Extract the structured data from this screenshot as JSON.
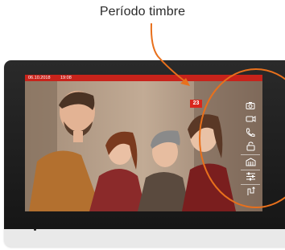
{
  "annotation": {
    "label": "Período timbre"
  },
  "status_bar": {
    "date": "06.10.2018",
    "time": "19:08"
  },
  "ring_counter": "23",
  "side_menu": {
    "items": [
      {
        "name": "snapshot",
        "icon": "camera-icon"
      },
      {
        "name": "record",
        "icon": "video-camera-icon"
      },
      {
        "name": "talk",
        "icon": "phone-handset-icon"
      },
      {
        "name": "unlock",
        "icon": "unlock-icon"
      },
      {
        "name": "gate",
        "icon": "gate-icon"
      },
      {
        "name": "settings",
        "icon": "sliders-icon"
      },
      {
        "name": "switch",
        "icon": "switch-icon"
      }
    ]
  },
  "colors": {
    "accent_red": "#d9261c",
    "annotation_orange": "#e8701c",
    "bezel": "#1b1b1b"
  }
}
